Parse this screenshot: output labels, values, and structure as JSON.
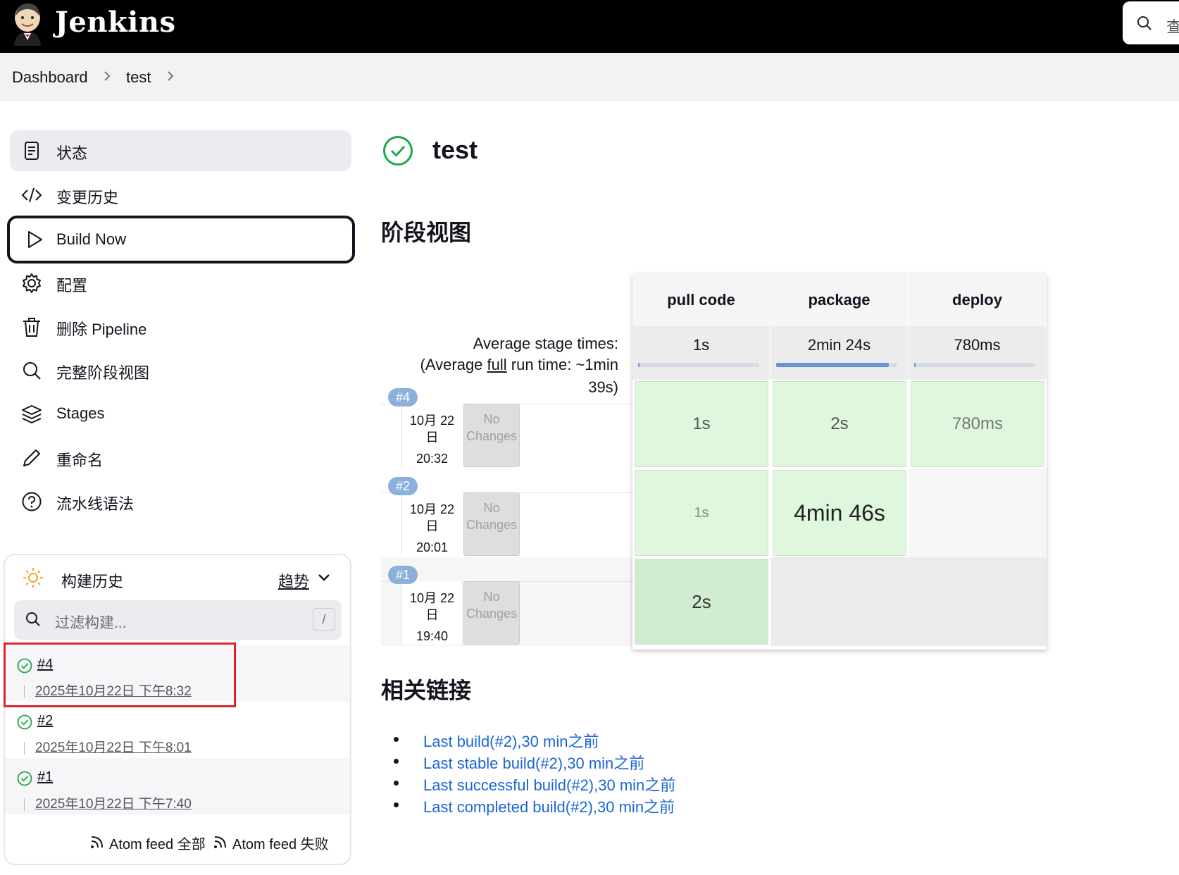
{
  "header": {
    "brand": "Jenkins",
    "search_placeholder": "查"
  },
  "breadcrumb": [
    {
      "label": "Dashboard"
    },
    {
      "label": "test"
    }
  ],
  "sidebar": {
    "items": [
      {
        "label": "状态",
        "icon": "document-icon",
        "active": true
      },
      {
        "label": "变更历史",
        "icon": "code-icon"
      },
      {
        "label": "Build Now",
        "icon": "play-icon",
        "focused": true
      },
      {
        "label": "配置",
        "icon": "gear-icon"
      },
      {
        "label": "删除 Pipeline",
        "icon": "trash-icon"
      },
      {
        "label": "完整阶段视图",
        "icon": "search-icon"
      },
      {
        "label": "Stages",
        "icon": "layers-icon"
      },
      {
        "label": "重命名",
        "icon": "pencil-icon"
      },
      {
        "label": "流水线语法",
        "icon": "help-icon"
      }
    ]
  },
  "build_history": {
    "title": "构建历史",
    "trend_label": "趋势",
    "filter_placeholder": "过滤构建...",
    "filter_shortcut": "/",
    "builds": [
      {
        "number": "#4",
        "date": "2025年10月22日 下午8:32",
        "status": "success"
      },
      {
        "number": "#2",
        "date": "2025年10月22日 下午8:01",
        "status": "success"
      },
      {
        "number": "#1",
        "date": "2025年10月22日 下午7:40",
        "status": "success"
      }
    ],
    "feed_all": "Atom feed 全部",
    "feed_failed": "Atom feed 失败"
  },
  "main": {
    "title": "test",
    "stage_view_title": "阶段视图",
    "links_title": "相关链接"
  },
  "stage_view": {
    "avg_label": "Average stage times:",
    "avg_full_prefix": "(Average ",
    "avg_full_word": "full",
    "avg_full_suffix": " run time: ~1min",
    "avg_full_tail": "39s)",
    "stages": [
      {
        "name": "pull code",
        "avg": "1s",
        "avg_fraction": 0.01
      },
      {
        "name": "package",
        "avg": "2min 24s",
        "avg_fraction": 0.93
      },
      {
        "name": "deploy",
        "avg": "780ms",
        "avg_fraction": 0.01
      }
    ],
    "runs": [
      {
        "badge": "#4",
        "date_line1": "10月 22",
        "date_line2": "日",
        "time": "20:32",
        "changes": "No Changes",
        "cells": [
          "1s",
          "2s",
          "780ms"
        ]
      },
      {
        "badge": "#2",
        "date_line1": "10月 22",
        "date_line2": "日",
        "time": "20:01",
        "changes": "No Changes",
        "cells": [
          "1s",
          "4min 46s",
          ""
        ]
      },
      {
        "badge": "#1",
        "date_line1": "10月 22",
        "date_line2": "日",
        "time": "19:40",
        "changes": "No Changes",
        "cells": [
          "2s",
          "",
          ""
        ]
      }
    ]
  },
  "links": [
    "Last build(#2),30 min之前",
    "Last stable build(#2),30 min之前",
    "Last successful build(#2),30 min之前",
    "Last completed build(#2),30 min之前"
  ],
  "colors": {
    "success": "#1ea64b",
    "link": "#1a66d6",
    "stage_ok": "#dff7dc",
    "highlight": "#e0222a"
  }
}
